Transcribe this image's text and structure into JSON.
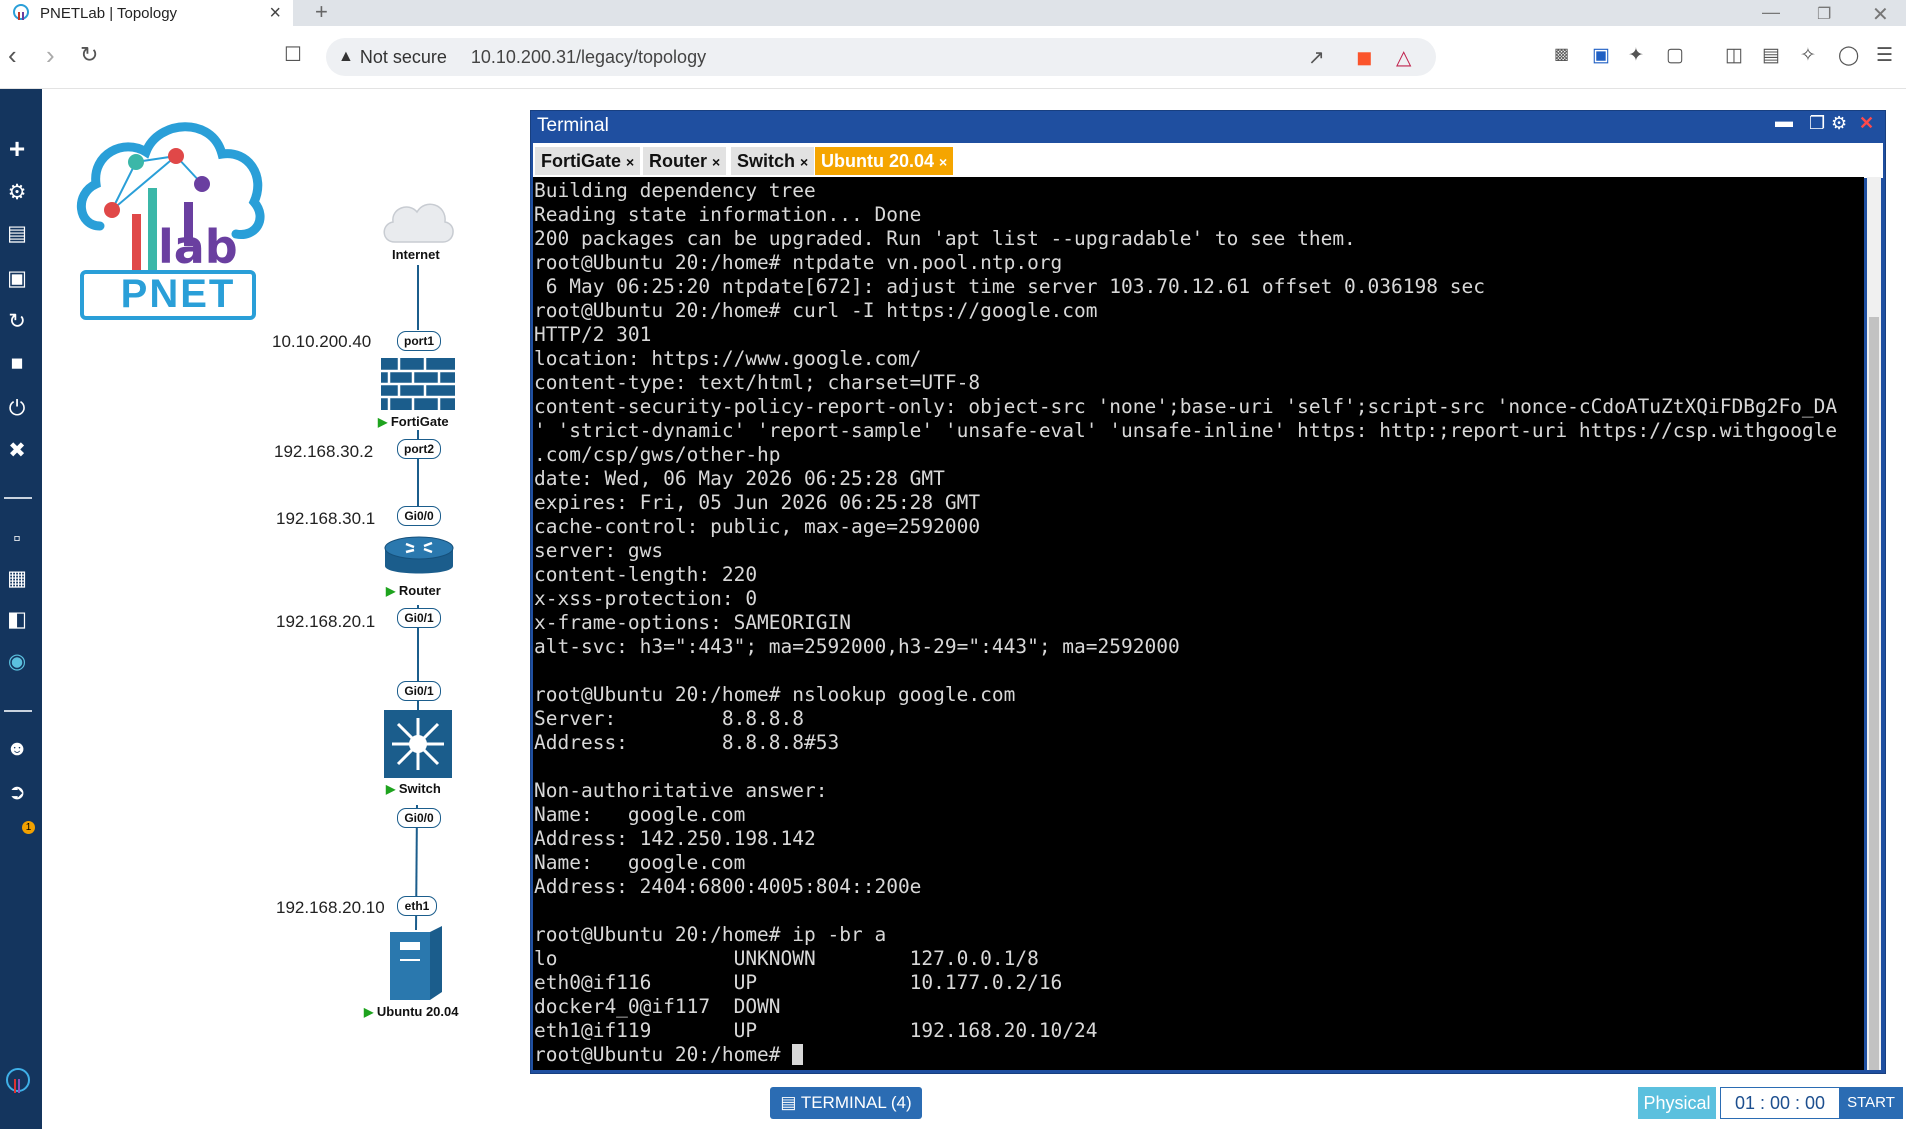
{
  "browser": {
    "tab_title": "PNETLab | Topology",
    "tab_close": "×",
    "new_tab": "+",
    "security_text": "Not secure",
    "url": "10.10.200.31/legacy/topology"
  },
  "logo": {
    "text_lab": "lab",
    "text_brand": "PNET"
  },
  "topology": {
    "nodes": {
      "internet": "Internet",
      "fortigate": "FortiGate",
      "router": "Router",
      "switch": "Switch",
      "ubuntu": "Ubuntu 20.04"
    },
    "ports": {
      "fg_port1": "port1",
      "fg_port2": "port2",
      "rt_gi00": "Gi0/0",
      "rt_gi01": "Gi0/1",
      "sw_gi01": "Gi0/1",
      "sw_gi00": "Gi0/0",
      "ub_eth1": "eth1"
    },
    "ips": {
      "fg_port1": "10.10.200.40",
      "fg_port2": "192.168.30.2",
      "rt_gi00": "192.168.30.1",
      "rt_gi01": "192.168.20.1",
      "ub_eth1": "192.168.20.10"
    }
  },
  "sidebar": {
    "notification_count": "1"
  },
  "terminal": {
    "title": "Terminal",
    "tabs": [
      "FortiGate",
      "Router",
      "Switch",
      "Ubuntu 20.04"
    ],
    "tab_close": "×",
    "active_tab": "Ubuntu 20.04",
    "output": "Building dependency tree\nReading state information... Done\n200 packages can be upgraded. Run 'apt list --upgradable' to see them.\nroot@Ubuntu 20:/home# ntpdate vn.pool.ntp.org\n 6 May 06:25:20 ntpdate[672]: adjust time server 103.70.12.61 offset 0.036198 sec\nroot@Ubuntu 20:/home# curl -I https://google.com\nHTTP/2 301\nlocation: https://www.google.com/\ncontent-type: text/html; charset=UTF-8\ncontent-security-policy-report-only: object-src 'none';base-uri 'self';script-src 'nonce-cCdoATuZtXQiFDBg2Fo_DA\n' 'strict-dynamic' 'report-sample' 'unsafe-eval' 'unsafe-inline' https: http:;report-uri https://csp.withgoogle\n.com/csp/gws/other-hp\ndate: Wed, 06 May 2026 06:25:28 GMT\nexpires: Fri, 05 Jun 2026 06:25:28 GMT\ncache-control: public, max-age=2592000\nserver: gws\ncontent-length: 220\nx-xss-protection: 0\nx-frame-options: SAMEORIGIN\nalt-svc: h3=\":443\"; ma=2592000,h3-29=\":443\"; ma=2592000\n\nroot@Ubuntu 20:/home# nslookup google.com\nServer:         8.8.8.8\nAddress:        8.8.8.8#53\n\nNon-authoritative answer:\nName:   google.com\nAddress: 142.250.198.142\nName:   google.com\nAddress: 2404:6800:4005:804::200e\n\nroot@Ubuntu 20:/home# ip -br a\nlo               UNKNOWN        127.0.0.1/8\neth0@if116       UP             10.177.0.2/16\ndocker4_0@if117  DOWN\neth1@if119       UP             192.168.20.10/24",
    "prompt": "root@Ubuntu 20:/home# "
  },
  "bottom": {
    "terminal_button": "TERMINAL (4)",
    "physical": "Physical",
    "timer": "01 : 00 : 00",
    "start": "START"
  },
  "colors": {
    "sidebar": "#14355e",
    "terminal_frame": "#1f4fa0",
    "active_tab": "#f5a500",
    "link_line": "#1b5d8c"
  }
}
